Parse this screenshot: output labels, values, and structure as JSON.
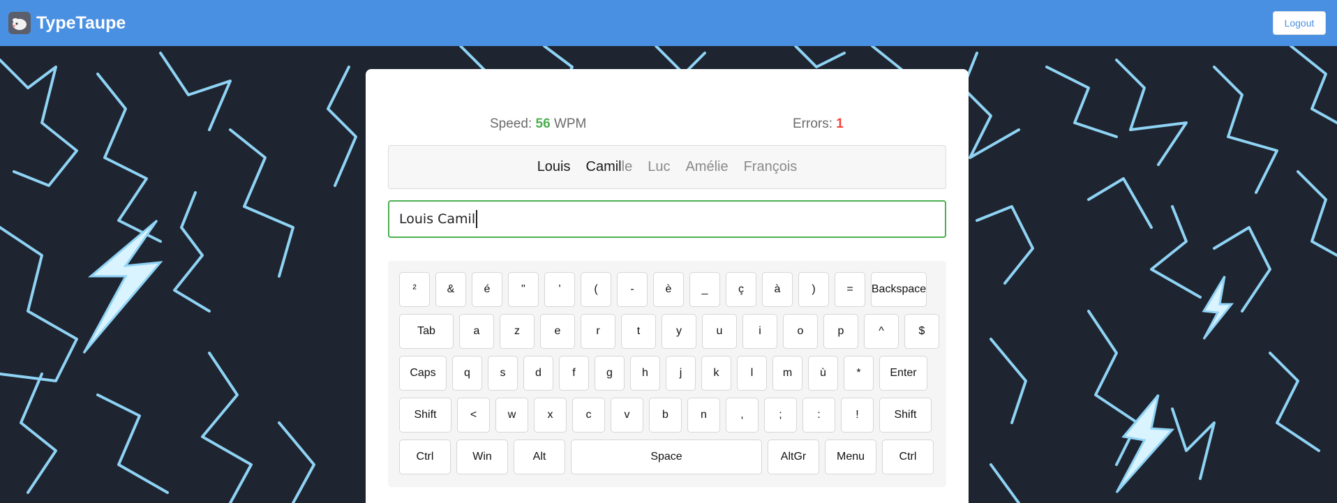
{
  "app": {
    "name": "TypeTaupe",
    "logout_label": "Logout"
  },
  "stats": {
    "speed_label": "Speed:",
    "speed_value": "56",
    "speed_unit": "WPM",
    "errors_label": "Errors:",
    "errors_value": "1"
  },
  "words": {
    "w1": "Louis",
    "w2_typed": "Camil",
    "w2_rest": "le",
    "w3": "Luc",
    "w4": "Amélie",
    "w5": "François"
  },
  "input": {
    "value": "Louis Camil"
  },
  "keyboard": {
    "row1": [
      "²",
      "&",
      "é",
      "\"",
      "'",
      "(",
      "-",
      "è",
      "_",
      "ç",
      "à",
      ")",
      "=",
      "Backspace"
    ],
    "row2": [
      "Tab",
      "a",
      "z",
      "e",
      "r",
      "t",
      "y",
      "u",
      "i",
      "o",
      "p",
      "^",
      "$"
    ],
    "row3": [
      "Caps",
      "q",
      "s",
      "d",
      "f",
      "g",
      "h",
      "j",
      "k",
      "l",
      "m",
      "ù",
      "*",
      "Enter"
    ],
    "row4": [
      "Shift",
      "<",
      "w",
      "x",
      "c",
      "v",
      "b",
      "n",
      ",",
      ";",
      ":",
      "!",
      "Shift"
    ],
    "row5": [
      "Ctrl",
      "Win",
      "Alt",
      "Space",
      "AltGr",
      "Menu",
      "Ctrl"
    ]
  },
  "colors": {
    "navbar": "#4a90e2",
    "background": "#1e2530",
    "lightning": "#8fd3f5",
    "speed": "#4caf50",
    "errors": "#f44336",
    "input_border": "#4caf50"
  },
  "icons": {
    "logo": "mole-logo-icon"
  }
}
